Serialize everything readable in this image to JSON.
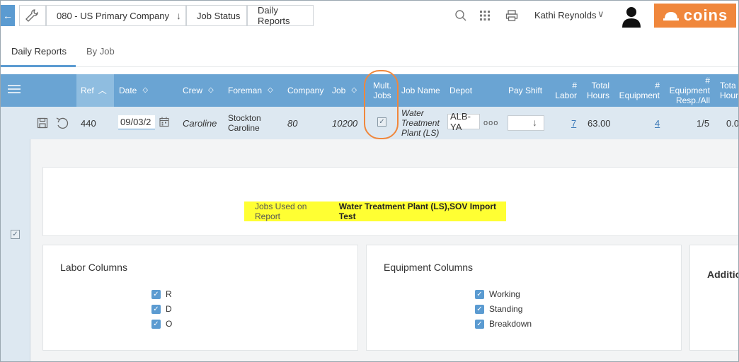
{
  "topbar": {
    "breadcrumbs": {
      "company": "080 - US Primary Company",
      "status": "Job Status",
      "reports": "Daily Reports"
    },
    "user_name": "Kathi Reynolds",
    "logo_text": "coins"
  },
  "tabs": [
    {
      "label": "Daily Reports",
      "active": true
    },
    {
      "label": "By Job",
      "active": false
    }
  ],
  "grid": {
    "headers": {
      "ref": "Ref",
      "date": "Date",
      "crew": "Crew",
      "foreman": "Foreman",
      "company": "Company",
      "job": "Job",
      "mult_jobs_1": "Mult.",
      "mult_jobs_2": "Jobs",
      "job_name": "Job Name",
      "depot": "Depot",
      "pay_shift": "Pay Shift",
      "labor_1": "#",
      "labor_2": "Labor",
      "total_hours_1": "Total",
      "total_hours_2": "Hours",
      "equipment_1": "#",
      "equipment_2": "Equipment",
      "equip_resp_1": "#",
      "equip_resp_2": "Equipment",
      "equip_resp_3": "Resp./All",
      "total_hours2_1": "Tota",
      "total_hours2_2": "Hour"
    },
    "row": {
      "ref": "440",
      "date": "09/03/2",
      "crew": "Caroline",
      "foreman_1": "Stockton",
      "foreman_2": "Caroline",
      "company": "80",
      "job": "10200",
      "job_name_1": "Water",
      "job_name_2": "Treatment",
      "job_name_3": "Plant (LS)",
      "depot": "ALB-YA",
      "labor": "7",
      "total_hours": "63.00",
      "equipment": "4",
      "equip_resp": "1/5",
      "total_hours2": "0.0"
    }
  },
  "details": {
    "jobs_used_label": "Jobs Used on Report",
    "jobs_used_value": "Water Treatment Plant (LS),SOV Import Test",
    "labor": {
      "title": "Labor Columns",
      "items": [
        "R",
        "D",
        "O"
      ]
    },
    "equipment": {
      "title": "Equipment Columns",
      "items": [
        "Working",
        "Standing",
        "Breakdown"
      ]
    },
    "additional": {
      "title": "Additio"
    }
  },
  "colors": {
    "accent": "#5b9bd1",
    "header": "#6aa4d3",
    "brand": "#f0873c",
    "highlight": "#ffff33",
    "row": "#dde8f1"
  }
}
